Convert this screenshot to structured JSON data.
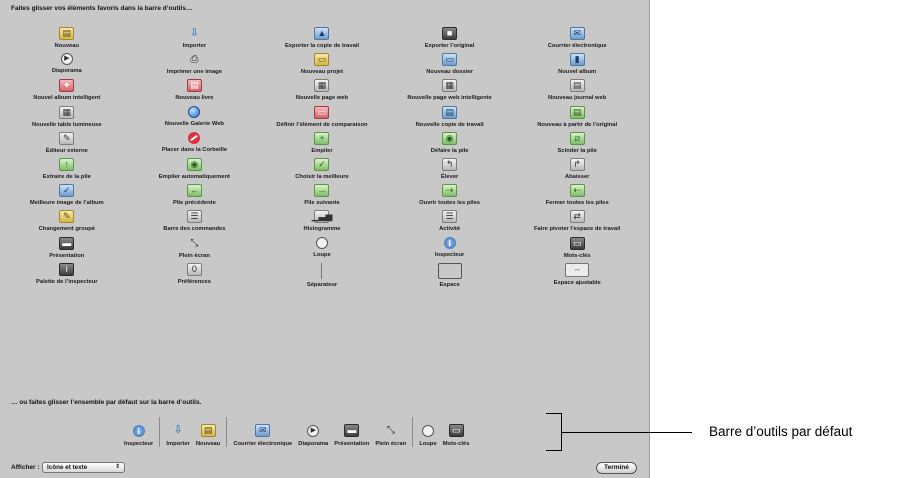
{
  "hints": {
    "top": "Faites glisser vos éléments favoris dans la barre d’outils…",
    "bottom": "… ou faites glisser l’ensemble par défaut sur la barre d’outils."
  },
  "items": [
    {
      "label": "Nouveau",
      "icon": "new-project-icon",
      "glyph": "▤",
      "style": "shape-yellow"
    },
    {
      "label": "Importer",
      "icon": "import-arrow-icon",
      "glyph": "⇩",
      "style": "shape-arrow"
    },
    {
      "label": "Exporter la copie de travail",
      "icon": "export-version-icon",
      "glyph": "▲",
      "style": "shape-blue"
    },
    {
      "label": "Exporter l’original",
      "icon": "export-master-icon",
      "glyph": "■",
      "style": "shape-dark"
    },
    {
      "label": "Courrier électronique",
      "icon": "email-stamp-icon",
      "glyph": "✉",
      "style": "shape-blue"
    },
    {
      "label": "Diaporama",
      "icon": "slideshow-play-icon",
      "glyph": "▶",
      "style": "shape-circle"
    },
    {
      "label": "Imprimer une image",
      "icon": "printer-icon",
      "glyph": "⎙",
      "style": "shape-none"
    },
    {
      "label": "Nouveau projet",
      "icon": "new-project-folder-icon",
      "glyph": "▭",
      "style": "shape-yellow"
    },
    {
      "label": "Nouveau dossier",
      "icon": "new-folder-icon",
      "glyph": "▭",
      "style": "shape-blue"
    },
    {
      "label": "Nouvel album",
      "icon": "new-album-icon",
      "glyph": "▮",
      "style": "shape-blue"
    },
    {
      "label": "Nouvel album intelligent",
      "icon": "smart-album-icon",
      "glyph": "✦",
      "style": "shape-red"
    },
    {
      "label": "Nouveau livre",
      "icon": "new-book-icon",
      "glyph": "▤",
      "style": "shape-red"
    },
    {
      "label": "Nouvelle page web",
      "icon": "web-page-icon",
      "glyph": "▦",
      "style": "shape-plain"
    },
    {
      "label": "Nouvelle page web intelligente",
      "icon": "smart-web-page-icon",
      "glyph": "▦",
      "style": "shape-plain"
    },
    {
      "label": "Nouveau journal web",
      "icon": "web-journal-icon",
      "glyph": "▤",
      "style": "shape-plain"
    },
    {
      "label": "Nouvelle table lumineuse",
      "icon": "light-table-icon",
      "glyph": "▦",
      "style": "shape-plain"
    },
    {
      "label": "Nouvelle Galerie Web",
      "icon": "web-gallery-globe-icon",
      "glyph": "",
      "style": "shape-globe"
    },
    {
      "label": "Définir l’élément de comparaison",
      "icon": "set-compare-icon",
      "glyph": "▭",
      "style": "shape-red"
    },
    {
      "label": "Nouvelle copie de travail",
      "icon": "new-version-icon",
      "glyph": "▤",
      "style": "shape-blue"
    },
    {
      "label": "Nouveau à partir de l’original",
      "icon": "new-from-master-icon",
      "glyph": "▤",
      "style": "shape-green"
    },
    {
      "label": "Éditeur externe",
      "icon": "external-editor-icon",
      "glyph": "✎",
      "style": "shape-plain"
    },
    {
      "label": "Placer dans la Corbeille",
      "icon": "trash-no-entry-icon",
      "glyph": "",
      "style": "shape-noentry"
    },
    {
      "label": "Empiler",
      "icon": "stack-icon",
      "glyph": "+",
      "style": "shape-green"
    },
    {
      "label": "Défaire la pile",
      "icon": "unstack-icon",
      "glyph": "◉",
      "style": "shape-green"
    },
    {
      "label": "Scinder la pile",
      "icon": "split-stack-icon",
      "glyph": "⧄",
      "style": "shape-green"
    },
    {
      "label": "Extraire de la pile",
      "icon": "extract-stack-icon",
      "glyph": "↑",
      "style": "shape-green"
    },
    {
      "label": "Empiler automatiquement",
      "icon": "auto-stack-icon",
      "glyph": "◉",
      "style": "shape-green"
    },
    {
      "label": "Choisir la meilleure",
      "icon": "pick-icon",
      "glyph": "✓",
      "style": "shape-green"
    },
    {
      "label": "Élever",
      "icon": "promote-icon",
      "glyph": "↰",
      "style": "shape-plain"
    },
    {
      "label": "Abaisser",
      "icon": "demote-icon",
      "glyph": "↱",
      "style": "shape-plain"
    },
    {
      "label": "Meilleure image de l’album",
      "icon": "album-pick-icon",
      "glyph": "✓",
      "style": "shape-blue"
    },
    {
      "label": "Pile précédente",
      "icon": "previous-stack-icon",
      "glyph": "←",
      "style": "shape-green"
    },
    {
      "label": "Pile suivante",
      "icon": "next-stack-icon",
      "glyph": "→",
      "style": "shape-green"
    },
    {
      "label": "Ouvrir toutes les piles",
      "icon": "open-stacks-icon",
      "glyph": "⇢",
      "style": "shape-green"
    },
    {
      "label": "Fermer toutes les piles",
      "icon": "close-stacks-icon",
      "glyph": "⇠",
      "style": "shape-green"
    },
    {
      "label": "Changement groupé",
      "icon": "batch-change-icon",
      "glyph": "✎",
      "style": "shape-yellow"
    },
    {
      "label": "Barre des commandes",
      "icon": "control-bar-icon",
      "glyph": "☰",
      "style": "shape-plain"
    },
    {
      "label": "Histogramme",
      "icon": "histogram-icon",
      "glyph": "▁▃▅",
      "style": "shape-plain"
    },
    {
      "label": "Activité",
      "icon": "activity-icon",
      "glyph": "☰",
      "style": "shape-plain"
    },
    {
      "label": "Faire pivoter l’espace de travail",
      "icon": "rotate-workspace-icon",
      "glyph": "⇄",
      "style": "shape-plain"
    },
    {
      "label": "Présentation",
      "icon": "layout-icon",
      "glyph": "▬",
      "style": "shape-dark"
    },
    {
      "label": "Plein écran",
      "icon": "full-screen-icon",
      "glyph": "⤡",
      "style": "shape-none"
    },
    {
      "label": "Loupe",
      "icon": "loupe-icon",
      "glyph": "",
      "style": "shape-circle"
    },
    {
      "label": "Inspecteur",
      "icon": "inspector-info-icon",
      "glyph": "i",
      "style": "shape-info"
    },
    {
      "label": "Mots-clés",
      "icon": "keywords-icon",
      "glyph": "▭",
      "style": "shape-dark"
    },
    {
      "label": "Palette de l’inspecteur",
      "icon": "inspector-palette-icon",
      "glyph": "i",
      "style": "shape-dark"
    },
    {
      "label": "Préférences",
      "icon": "preferences-icon",
      "glyph": "0",
      "style": "shape-plain"
    },
    {
      "label": "Séparateur",
      "icon": "separator-icon",
      "glyph": "",
      "style": "shape-sep"
    },
    {
      "label": "Espace",
      "icon": "space-box-icon",
      "glyph": "",
      "style": "shape-box"
    },
    {
      "label": "Espace ajustable",
      "icon": "flexible-space-icon",
      "glyph": "↔",
      "style": "shape-flex"
    }
  ],
  "default_bar": [
    {
      "label": "Inspecteur",
      "icon": "inspector-info-icon",
      "glyph": "i",
      "style": "shape-info"
    },
    {
      "sep": true
    },
    {
      "label": "Importer",
      "icon": "import-arrow-icon",
      "glyph": "⇩",
      "style": "shape-arrow"
    },
    {
      "label": "Nouveau",
      "icon": "new-project-icon",
      "glyph": "▤",
      "style": "shape-yellow"
    },
    {
      "sep": true
    },
    {
      "label": "Courrier électronique",
      "icon": "email-stamp-icon",
      "glyph": "✉",
      "style": "shape-blue"
    },
    {
      "label": "Diaporama",
      "icon": "slideshow-play-icon",
      "glyph": "▶",
      "style": "shape-circle"
    },
    {
      "label": "Présentation",
      "icon": "layout-icon",
      "glyph": "▬",
      "style": "shape-dark"
    },
    {
      "label": "Plein écran",
      "icon": "full-screen-icon",
      "glyph": "⤡",
      "style": "shape-none"
    },
    {
      "sep": true
    },
    {
      "label": "Loupe",
      "icon": "loupe-icon",
      "glyph": "",
      "style": "shape-circle"
    },
    {
      "label": "Mots-clés",
      "icon": "keywords-icon",
      "glyph": "▭",
      "style": "shape-dark"
    }
  ],
  "callout": "Barre d’outils par défaut",
  "footer": {
    "show_label": "Afficher :",
    "show_value": "Icône et texte",
    "done_label": "Terminé"
  }
}
